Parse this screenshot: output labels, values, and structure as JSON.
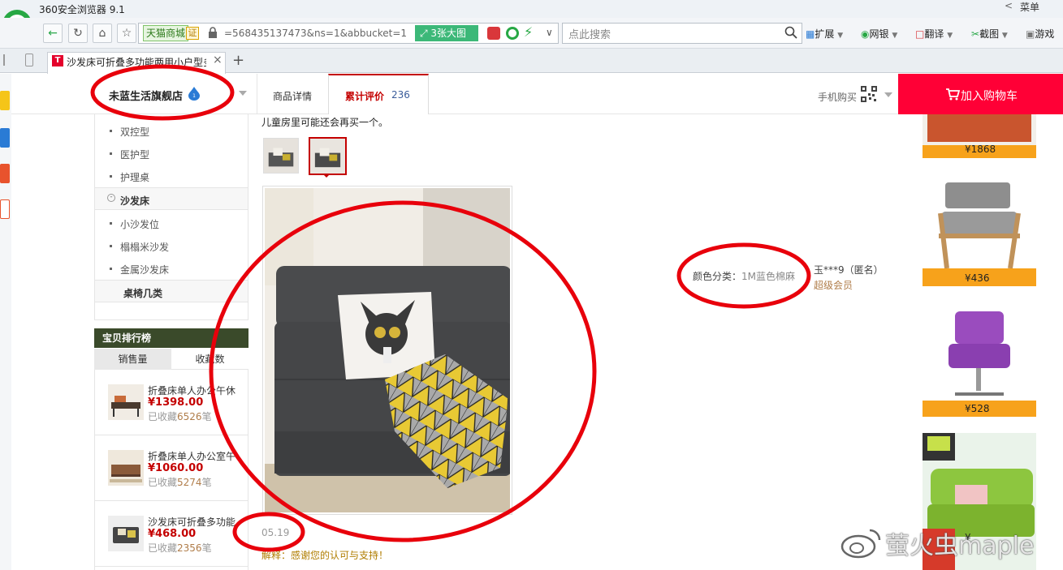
{
  "browser": {
    "app_title": "360安全浏览器 9.1",
    "back_label": "<",
    "menu_label": "菜单",
    "tmall_chip": "天猫商城",
    "cert_chip": "证",
    "url": "=568435137473&ns=1&abbucket=1",
    "big_image_button": "3张大图",
    "search_placeholder": "点此搜索",
    "tools": [
      "扩展",
      "网银",
      "翻译",
      "截图",
      "游戏"
    ],
    "tab_title": "沙发床可折叠多功能两用小户型多",
    "tab_favicon": "T",
    "tab_close": "×",
    "tab_new": "+"
  },
  "shop": {
    "name": "未蓝生活旗舰店",
    "tabs": {
      "detail": "商品详情",
      "reviews": "累计评价",
      "reviews_count": "236"
    },
    "mobile_buy": "手机购买",
    "cart_button": "加入购物车",
    "accent": "#ff0036"
  },
  "categories": {
    "items_top": [
      "双控型",
      "医护型",
      "护理桌"
    ],
    "group": "沙发床",
    "items_group": [
      "小沙发位",
      "榻榻米沙发",
      "金属沙发床"
    ],
    "group2": "桌椅几类"
  },
  "ranking": {
    "title": "宝贝排行榜",
    "tab_sales": "销售量",
    "tab_fav": "收藏数",
    "items": [
      {
        "name": "折叠床单人办公午休",
        "price": "¥1398.00",
        "fav_prefix": "已收藏",
        "fav_count": "6526",
        "fav_suffix": "笔"
      },
      {
        "name": "折叠床单人办公室午",
        "price": "¥1060.00",
        "fav_prefix": "已收藏",
        "fav_count": "5274",
        "fav_suffix": "笔"
      },
      {
        "name": "沙发床可折叠多功能",
        "price": "¥468.00",
        "fav_prefix": "已收藏",
        "fav_count": "2356",
        "fav_suffix": "笔"
      }
    ]
  },
  "review": {
    "text": "儿童房里可能还会再买一个。",
    "date": "05.19",
    "reply": "解释：感谢您的认可与支持！",
    "sku_label": "颜色分类：",
    "sku_value": "1M蓝色棉麻",
    "user": "玉***9（匿名）",
    "user_level": "超级会员"
  },
  "recommend": {
    "prices": [
      "¥1868",
      "¥436",
      "¥528",
      "¥"
    ]
  },
  "watermark": "萤火虫maple"
}
